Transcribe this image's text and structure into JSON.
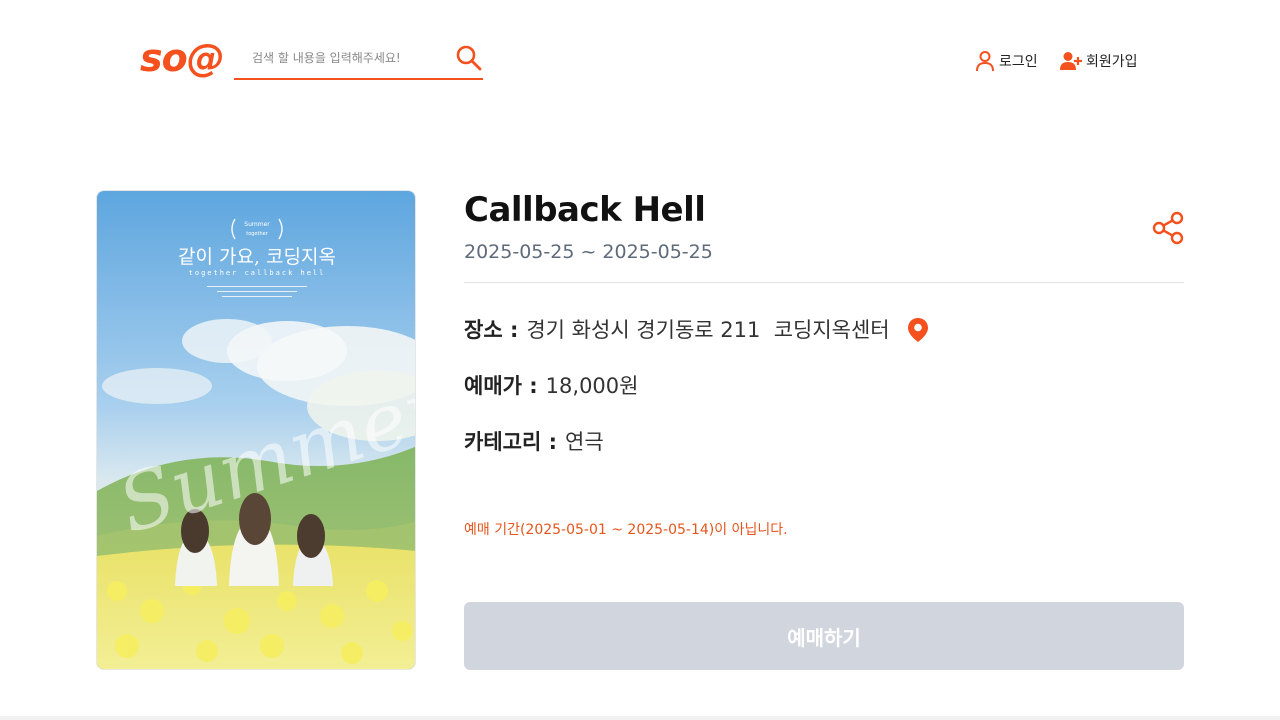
{
  "header": {
    "logo": "so@",
    "search_placeholder": "검색 할 내용을 입력해주세요!",
    "login_label": "로그인",
    "signup_label": "회원가입"
  },
  "poster": {
    "title_text": "같이 가요, 코딩지옥",
    "subtitle_text": "together callback hell",
    "script_text": "Summer"
  },
  "event": {
    "title": "Callback Hell",
    "dates": "2025-05-25 ~ 2025-05-25",
    "place_label": "장소 :",
    "place_value": "경기 화성시 경기동로 211  코딩지옥센터",
    "price_label": "예매가 :",
    "price_value": "18,000원",
    "category_label": "카테고리 :",
    "category_value": "연극",
    "notice": "예매 기간(2025-05-01 ~ 2025-05-14)이 아닙니다.",
    "book_button": "예매하기"
  },
  "colors": {
    "brand": "#f4511e",
    "disabled_button": "#d1d6de",
    "notice": "#e4561d"
  },
  "icons": [
    "search-icon",
    "user-icon",
    "user-plus-icon",
    "share-icon",
    "map-pin-icon"
  ]
}
